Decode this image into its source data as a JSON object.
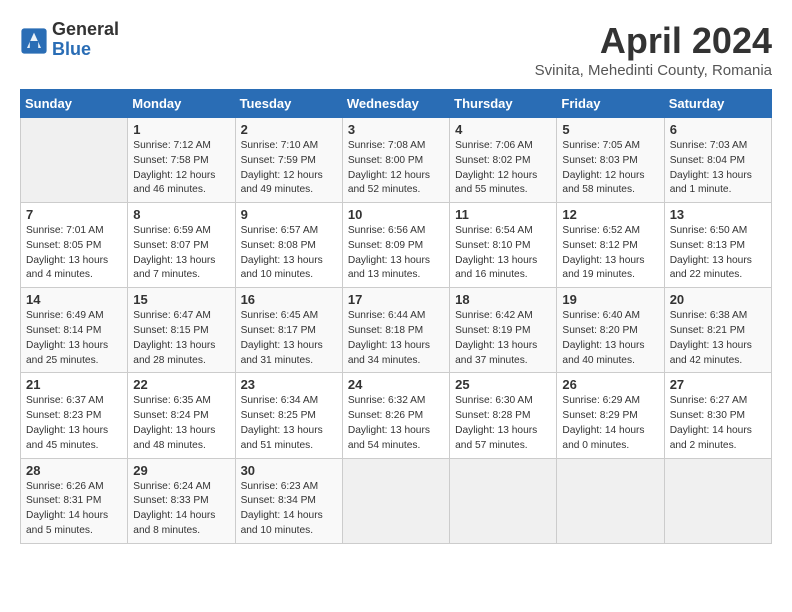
{
  "header": {
    "logo_general": "General",
    "logo_blue": "Blue",
    "month_title": "April 2024",
    "subtitle": "Svinita, Mehedinti County, Romania"
  },
  "days_of_week": [
    "Sunday",
    "Monday",
    "Tuesday",
    "Wednesday",
    "Thursday",
    "Friday",
    "Saturday"
  ],
  "weeks": [
    [
      {
        "day": "",
        "content": ""
      },
      {
        "day": "1",
        "content": "Sunrise: 7:12 AM\nSunset: 7:58 PM\nDaylight: 12 hours\nand 46 minutes."
      },
      {
        "day": "2",
        "content": "Sunrise: 7:10 AM\nSunset: 7:59 PM\nDaylight: 12 hours\nand 49 minutes."
      },
      {
        "day": "3",
        "content": "Sunrise: 7:08 AM\nSunset: 8:00 PM\nDaylight: 12 hours\nand 52 minutes."
      },
      {
        "day": "4",
        "content": "Sunrise: 7:06 AM\nSunset: 8:02 PM\nDaylight: 12 hours\nand 55 minutes."
      },
      {
        "day": "5",
        "content": "Sunrise: 7:05 AM\nSunset: 8:03 PM\nDaylight: 12 hours\nand 58 minutes."
      },
      {
        "day": "6",
        "content": "Sunrise: 7:03 AM\nSunset: 8:04 PM\nDaylight: 13 hours\nand 1 minute."
      }
    ],
    [
      {
        "day": "7",
        "content": "Sunrise: 7:01 AM\nSunset: 8:05 PM\nDaylight: 13 hours\nand 4 minutes."
      },
      {
        "day": "8",
        "content": "Sunrise: 6:59 AM\nSunset: 8:07 PM\nDaylight: 13 hours\nand 7 minutes."
      },
      {
        "day": "9",
        "content": "Sunrise: 6:57 AM\nSunset: 8:08 PM\nDaylight: 13 hours\nand 10 minutes."
      },
      {
        "day": "10",
        "content": "Sunrise: 6:56 AM\nSunset: 8:09 PM\nDaylight: 13 hours\nand 13 minutes."
      },
      {
        "day": "11",
        "content": "Sunrise: 6:54 AM\nSunset: 8:10 PM\nDaylight: 13 hours\nand 16 minutes."
      },
      {
        "day": "12",
        "content": "Sunrise: 6:52 AM\nSunset: 8:12 PM\nDaylight: 13 hours\nand 19 minutes."
      },
      {
        "day": "13",
        "content": "Sunrise: 6:50 AM\nSunset: 8:13 PM\nDaylight: 13 hours\nand 22 minutes."
      }
    ],
    [
      {
        "day": "14",
        "content": "Sunrise: 6:49 AM\nSunset: 8:14 PM\nDaylight: 13 hours\nand 25 minutes."
      },
      {
        "day": "15",
        "content": "Sunrise: 6:47 AM\nSunset: 8:15 PM\nDaylight: 13 hours\nand 28 minutes."
      },
      {
        "day": "16",
        "content": "Sunrise: 6:45 AM\nSunset: 8:17 PM\nDaylight: 13 hours\nand 31 minutes."
      },
      {
        "day": "17",
        "content": "Sunrise: 6:44 AM\nSunset: 8:18 PM\nDaylight: 13 hours\nand 34 minutes."
      },
      {
        "day": "18",
        "content": "Sunrise: 6:42 AM\nSunset: 8:19 PM\nDaylight: 13 hours\nand 37 minutes."
      },
      {
        "day": "19",
        "content": "Sunrise: 6:40 AM\nSunset: 8:20 PM\nDaylight: 13 hours\nand 40 minutes."
      },
      {
        "day": "20",
        "content": "Sunrise: 6:38 AM\nSunset: 8:21 PM\nDaylight: 13 hours\nand 42 minutes."
      }
    ],
    [
      {
        "day": "21",
        "content": "Sunrise: 6:37 AM\nSunset: 8:23 PM\nDaylight: 13 hours\nand 45 minutes."
      },
      {
        "day": "22",
        "content": "Sunrise: 6:35 AM\nSunset: 8:24 PM\nDaylight: 13 hours\nand 48 minutes."
      },
      {
        "day": "23",
        "content": "Sunrise: 6:34 AM\nSunset: 8:25 PM\nDaylight: 13 hours\nand 51 minutes."
      },
      {
        "day": "24",
        "content": "Sunrise: 6:32 AM\nSunset: 8:26 PM\nDaylight: 13 hours\nand 54 minutes."
      },
      {
        "day": "25",
        "content": "Sunrise: 6:30 AM\nSunset: 8:28 PM\nDaylight: 13 hours\nand 57 minutes."
      },
      {
        "day": "26",
        "content": "Sunrise: 6:29 AM\nSunset: 8:29 PM\nDaylight: 14 hours\nand 0 minutes."
      },
      {
        "day": "27",
        "content": "Sunrise: 6:27 AM\nSunset: 8:30 PM\nDaylight: 14 hours\nand 2 minutes."
      }
    ],
    [
      {
        "day": "28",
        "content": "Sunrise: 6:26 AM\nSunset: 8:31 PM\nDaylight: 14 hours\nand 5 minutes."
      },
      {
        "day": "29",
        "content": "Sunrise: 6:24 AM\nSunset: 8:33 PM\nDaylight: 14 hours\nand 8 minutes."
      },
      {
        "day": "30",
        "content": "Sunrise: 6:23 AM\nSunset: 8:34 PM\nDaylight: 14 hours\nand 10 minutes."
      },
      {
        "day": "",
        "content": ""
      },
      {
        "day": "",
        "content": ""
      },
      {
        "day": "",
        "content": ""
      },
      {
        "day": "",
        "content": ""
      }
    ]
  ]
}
